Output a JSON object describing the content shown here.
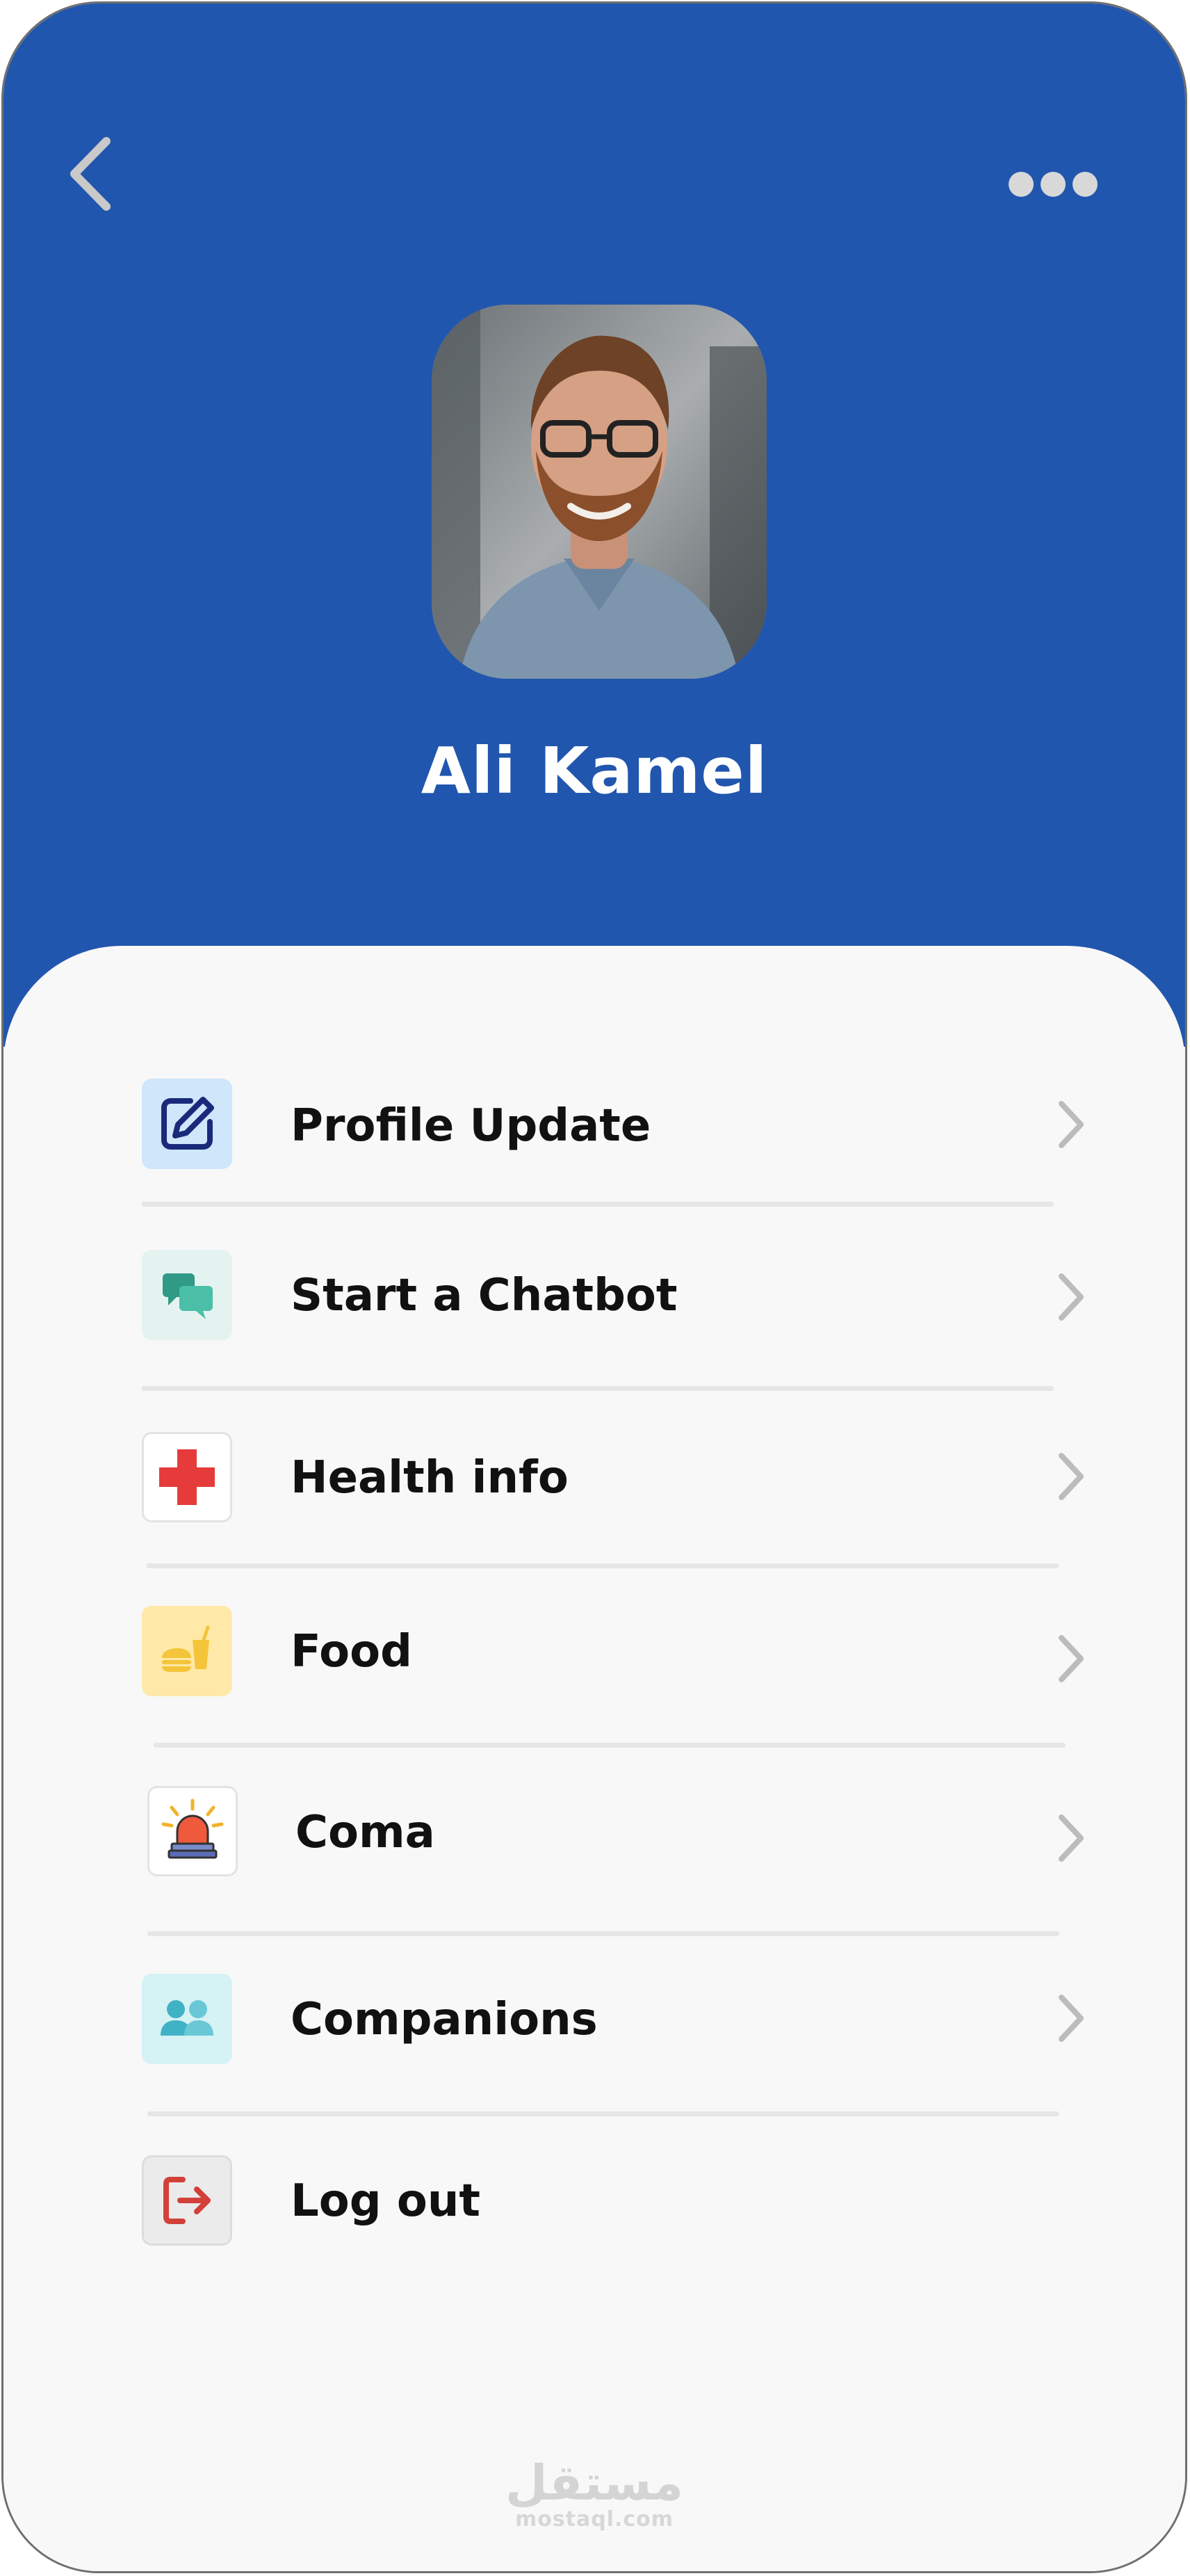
{
  "colors": {
    "header_bg": "#2156ae",
    "sheet_bg": "#f8f8f8",
    "text": "#111111",
    "chevron": "#bcbcbc"
  },
  "header": {
    "back_icon": "chevron-left-icon",
    "more_icon": "more-horizontal-icon"
  },
  "profile": {
    "name": "Ali Kamel",
    "avatar": "profile-photo"
  },
  "menu": {
    "items": [
      {
        "label": "Profile Update",
        "icon": "edit-icon"
      },
      {
        "label": "Start a Chatbot",
        "icon": "chat-bubbles-icon"
      },
      {
        "label": "Health info",
        "icon": "medical-cross-icon"
      },
      {
        "label": "Food",
        "icon": "burger-drink-icon"
      },
      {
        "label": "Coma",
        "icon": "siren-icon"
      },
      {
        "label": "Companions",
        "icon": "people-icon"
      },
      {
        "label": "Log out",
        "icon": "logout-icon"
      }
    ]
  },
  "watermark": {
    "arabic": "مستقل",
    "latin": "mostaql.com"
  }
}
